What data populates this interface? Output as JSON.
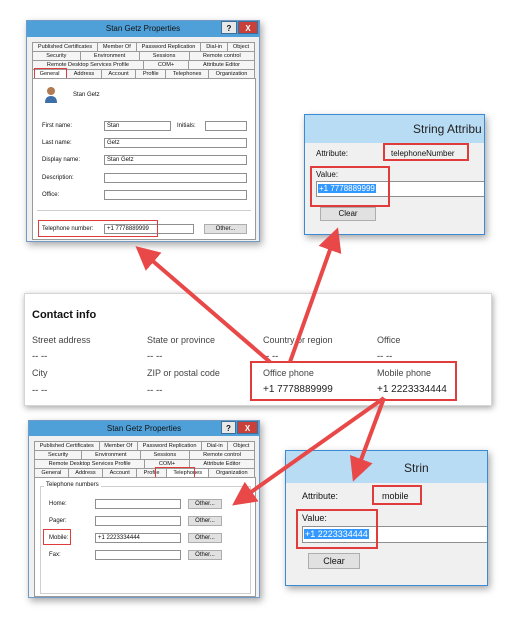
{
  "props1": {
    "title": "Stan Getz Properties",
    "help": "?",
    "close": "X",
    "tabs_row1": [
      "Published Certificates",
      "Member Of",
      "Password Replication",
      "Dial-in",
      "Object"
    ],
    "tabs_row2": [
      "Security",
      "Environment",
      "Sessions",
      "Remote control"
    ],
    "tabs_row3": [
      "Remote Desktop Services Profile",
      "COM+",
      "Attribute Editor"
    ],
    "tabs_row4": [
      "General",
      "Address",
      "Account",
      "Profile",
      "Telephones",
      "Organization"
    ],
    "user_name": "Stan Getz",
    "first_name_label": "First name:",
    "first_name": "Stan",
    "initials_label": "Initials:",
    "initials": "",
    "last_name_label": "Last name:",
    "last_name": "Getz",
    "display_name_label": "Display name:",
    "display_name": "Stan Getz",
    "description_label": "Description:",
    "description": "",
    "office_label": "Office:",
    "office": "",
    "telephone_label": "Telephone number:",
    "telephone": "+1 7778889999",
    "other_label": "Other..."
  },
  "string1": {
    "title": "String Attribu",
    "attribute_label": "Attribute:",
    "attribute": "telephoneNumber",
    "value_label": "Value:",
    "value": "+1 7778889999",
    "clear_label": "Clear"
  },
  "contact": {
    "heading": "Contact info",
    "street_label": "Street address",
    "street": "-- --",
    "state_label": "State or province",
    "state": "-- --",
    "country_label": "Country or region",
    "country": "-- --",
    "office_label": "Office",
    "office": "-- --",
    "city_label": "City",
    "city": "-- --",
    "zip_label": "ZIP or postal code",
    "zip": "-- --",
    "office_phone_label": "Office phone",
    "office_phone": "+1 7778889999",
    "mobile_label": "Mobile phone",
    "mobile": "+1 2223334444"
  },
  "props2": {
    "title": "Stan Getz Properties",
    "help": "?",
    "close": "X",
    "tabs_row1": [
      "Published Certificates",
      "Member Of",
      "Password Replication",
      "Dial-in",
      "Object"
    ],
    "tabs_row2": [
      "Security",
      "Environment",
      "Sessions",
      "Remote control"
    ],
    "tabs_row3": [
      "Remote Desktop Services Profile",
      "COM+",
      "Attribute Editor"
    ],
    "tabs_row4": [
      "General",
      "Address",
      "Account",
      "Profile",
      "Telephones",
      "Organization"
    ],
    "group_label": "Telephone numbers",
    "home_label": "Home:",
    "home": "",
    "pager_label": "Pager:",
    "pager": "",
    "mobile_label": "Mobile:",
    "mobile": "+1 2223334444",
    "fax_label": "Fax:",
    "fax": "",
    "other_label": "Other..."
  },
  "string2": {
    "title": "Strin",
    "attribute_label": "Attribute:",
    "attribute": "mobile",
    "value_label": "Value:",
    "value": "+1 2223334444",
    "clear_label": "Clear"
  },
  "colors": {
    "titlebar": "#4fa0d8",
    "close_button": "#c9403a",
    "highlight_box": "#e03c3c",
    "selection": "#3399ff"
  },
  "icons": [
    "user-icon",
    "arrow-icon"
  ]
}
